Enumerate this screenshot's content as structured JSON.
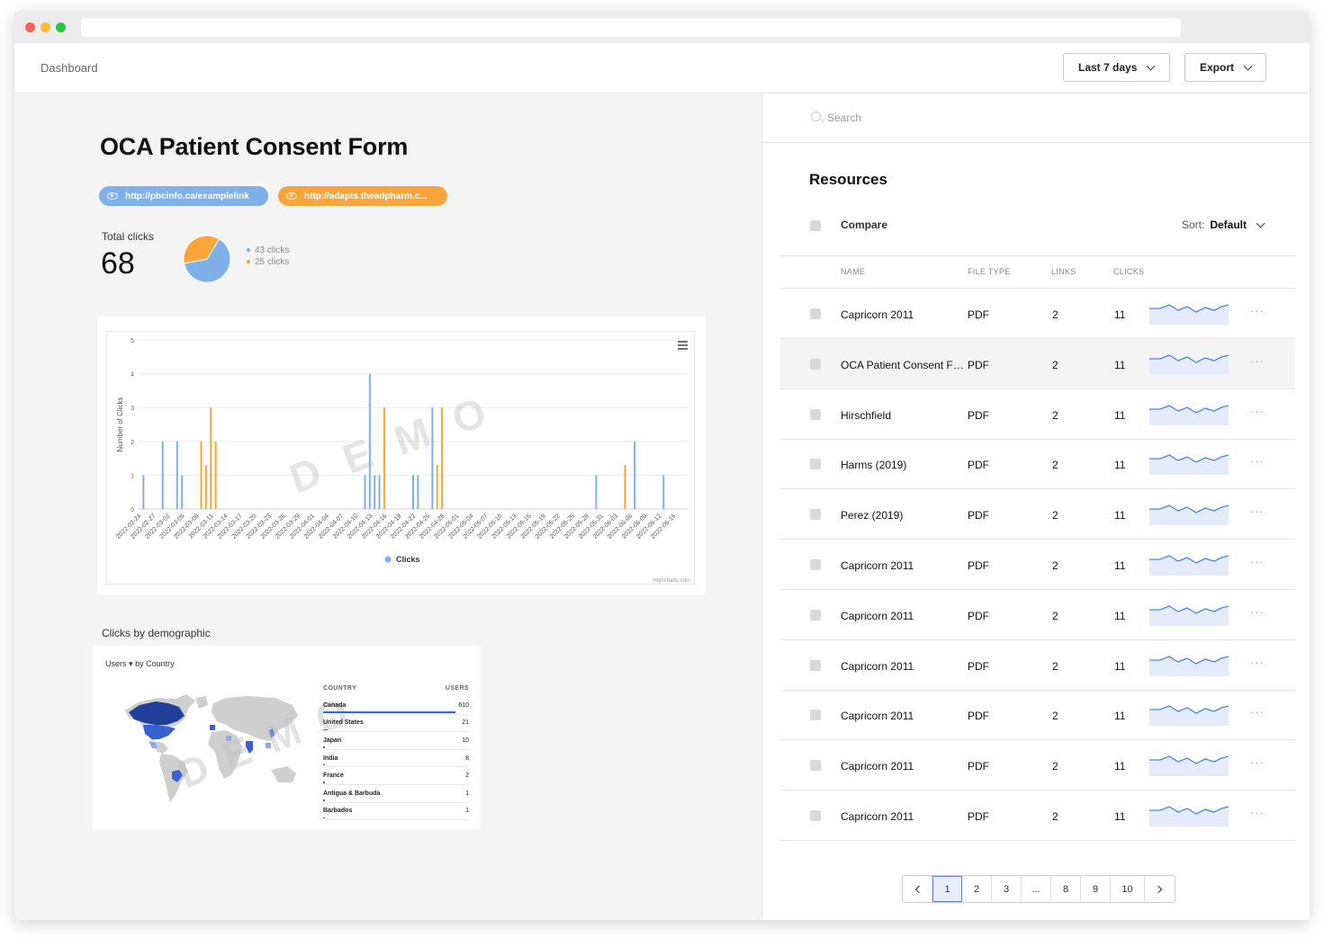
{
  "header": {
    "breadcrumb": "Dashboard",
    "date_range": "Last 7 days",
    "export_label": "Export"
  },
  "main": {
    "title": "OCA Patient Consent Form",
    "links": [
      {
        "url": "http://pbcinfo.ca/examplelink",
        "color": "#7fb0ea"
      },
      {
        "url": "http://adapts.theadpharm.c...",
        "color": "#fba43a"
      }
    ],
    "total_clicks_label": "Total clicks",
    "total_clicks": "68",
    "pie_legend": [
      "43 clicks",
      "25 clicks"
    ],
    "demographic_label": "Clicks by demographic"
  },
  "chart_data": [
    {
      "type": "pie",
      "values": [
        43,
        25
      ],
      "colors": [
        "#7fb0ea",
        "#fba43a"
      ]
    },
    {
      "type": "bar",
      "ylabel": "Number of Clicks",
      "ylim": [
        0,
        5
      ],
      "yticks": [
        0,
        1,
        2,
        3,
        4,
        5
      ],
      "xlim": [
        "2022-02-24",
        "2022-06-18"
      ],
      "x_ticks": [
        "2022-02-24",
        "2022-02-27",
        "2022-03-02",
        "2022-03-05",
        "2022-03-08",
        "2022-03-11",
        "2022-03-14",
        "2022-03-17",
        "2022-03-20",
        "2022-03-23",
        "2022-03-26",
        "2022-03-29",
        "2022-04-01",
        "2022-04-04",
        "2022-04-07",
        "2022-04-10",
        "2022-04-13",
        "2022-04-16",
        "2022-04-19",
        "2022-04-22",
        "2022-04-25",
        "2022-04-28",
        "2022-05-01",
        "2022-05-04",
        "2022-05-07",
        "2022-05-10",
        "2022-05-13",
        "2022-05-16",
        "2022-05-19",
        "2022-05-22",
        "2022-05-25",
        "2022-05-28",
        "2022-05-31",
        "2022-06-03",
        "2022-06-06",
        "2022-06-09",
        "2022-06-12",
        "2022-06-15"
      ],
      "grid": true,
      "legend": "bottom-center",
      "watermark": "DEMO",
      "credits": "Highcharts.com",
      "series": [
        {
          "name": "Clicks",
          "color": "#7fb0ea",
          "points": [
            [
              "2022-02-25",
              1
            ],
            [
              "2022-03-01",
              2
            ],
            [
              "2022-03-04",
              2
            ],
            [
              "2022-03-05",
              1
            ],
            [
              "2022-04-12",
              1
            ],
            [
              "2022-04-13",
              4
            ],
            [
              "2022-04-14",
              1
            ],
            [
              "2022-04-15",
              1
            ],
            [
              "2022-04-22",
              1
            ],
            [
              "2022-04-23",
              1
            ],
            [
              "2022-04-26",
              3
            ],
            [
              "2022-05-30",
              1
            ],
            [
              "2022-06-07",
              2
            ],
            [
              "2022-06-13",
              1
            ]
          ]
        },
        {
          "name": "",
          "color": "#fba43a",
          "points": [
            [
              "2022-03-09",
              2
            ],
            [
              "2022-03-10",
              1.3
            ],
            [
              "2022-03-11",
              3
            ],
            [
              "2022-03-12",
              2
            ],
            [
              "2022-04-16",
              3
            ],
            [
              "2022-04-27",
              1.3
            ],
            [
              "2022-04-28",
              3
            ],
            [
              "2022-06-05",
              1.3
            ]
          ]
        }
      ]
    }
  ],
  "geo": {
    "metric": "Users",
    "metric_caret": "▾",
    "dimension": "by Country",
    "col_country": "COUNTRY",
    "col_users": "USERS",
    "watermark": "DEMO",
    "rows": [
      {
        "country": "Canada",
        "users": "610",
        "share": 1.0
      },
      {
        "country": "United States",
        "users": "21",
        "share": 0.034
      },
      {
        "country": "Japan",
        "users": "10",
        "share": 0.016
      },
      {
        "country": "India",
        "users": "8",
        "share": 0.013
      },
      {
        "country": "France",
        "users": "2",
        "share": 0.003
      },
      {
        "country": "Antigua & Barbuda",
        "users": "1",
        "share": 0.002
      },
      {
        "country": "Barbados",
        "users": "1",
        "share": 0.002
      }
    ]
  },
  "resources": {
    "search_placeholder": "Search",
    "title": "Resources",
    "compare_label": "Compare",
    "sort_label": "Sort:",
    "sort_value": "Default",
    "columns": {
      "name": "NAME",
      "file_type": "FILE TYPE",
      "links": "LINKS",
      "clicks": "CLICKS"
    },
    "more_glyph": "···",
    "rows": [
      {
        "name": "Capricorn 2011",
        "file_type": "PDF",
        "links": "2",
        "clicks": "11"
      },
      {
        "name": "OCA Patient Consent Form",
        "file_type": "PDF",
        "links": "2",
        "clicks": "11"
      },
      {
        "name": "Hirschfield",
        "file_type": "PDF",
        "links": "2",
        "clicks": "11"
      },
      {
        "name": "Harms (2019)",
        "file_type": "PDF",
        "links": "2",
        "clicks": "11"
      },
      {
        "name": "Perez (2019)",
        "file_type": "PDF",
        "links": "2",
        "clicks": "11"
      },
      {
        "name": "Capricorn 2011",
        "file_type": "PDF",
        "links": "2",
        "clicks": "11"
      },
      {
        "name": "Capricorn 2011",
        "file_type": "PDF",
        "links": "2",
        "clicks": "11"
      },
      {
        "name": "Capricorn 2011",
        "file_type": "PDF",
        "links": "2",
        "clicks": "11"
      },
      {
        "name": "Capricorn 2011",
        "file_type": "PDF",
        "links": "2",
        "clicks": "11"
      },
      {
        "name": "Capricorn 2011",
        "file_type": "PDF",
        "links": "2",
        "clicks": "11"
      },
      {
        "name": "Capricorn 2011",
        "file_type": "PDF",
        "links": "2",
        "clicks": "11"
      }
    ],
    "highlighted_row": 1,
    "pagination": {
      "pages": [
        "1",
        "2",
        "3",
        "...",
        "8",
        "9",
        "10"
      ],
      "current": "1"
    }
  }
}
